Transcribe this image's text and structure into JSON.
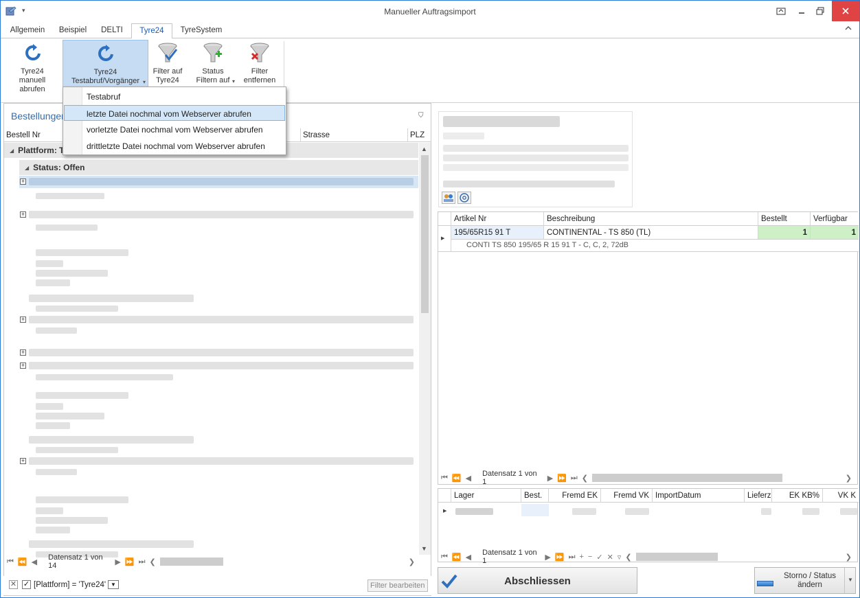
{
  "window": {
    "title": "Manueller Auftragsimport",
    "qat_symbol": "▾"
  },
  "tabs": [
    "Allgemein",
    "Beispiel",
    "DELTI",
    "Tyre24",
    "TyreSystem"
  ],
  "active_tab": "Tyre24",
  "ribbon": {
    "btn_manual": "Tyre24 manuell abrufen",
    "btn_test_line1": "Tyre24",
    "btn_test_line2": "Testabruf/Vorgänger",
    "btn_filter_line1": "Filter auf",
    "btn_filter_line2": "Tyre24",
    "btn_status_line1": "Status",
    "btn_status_line2": "Filtern auf",
    "btn_remove_line1": "Filter",
    "btn_remove_line2": "entfernen"
  },
  "dropdown": {
    "items": [
      "Testabruf",
      "letzte  Datei nochmal vom Webserver abrufen",
      "vorletzte  Datei nochmal vom Webserver abrufen",
      "drittletzte  Datei nochmal vom Webserver abrufen"
    ],
    "selected_index": 1
  },
  "left": {
    "title": "Bestellungen",
    "columns": [
      "Bestell Nr",
      "Strasse",
      "PLZ"
    ],
    "group_platform": "Plattform: T",
    "group_status": "Status: Offen",
    "nav_record": "Datensatz 1 von 14",
    "filter_text": "[Plattform] = 'Tyre24'",
    "filter_edit": "Filter bearbeiten"
  },
  "articles": {
    "columns": [
      "Artikel Nr",
      "Beschreibung",
      "Bestellt",
      "Verfügbar"
    ],
    "rows": [
      {
        "artikel_nr": "195/65R15 91 T",
        "beschreibung": "CONTINENTAL - TS 850 (TL)",
        "bestellt": "1",
        "verfuegbar": "1"
      }
    ],
    "detail": "CONTI    TS 850 195/65 R 15 91 T - C, C, 2, 72dB",
    "nav_record": "Datensatz 1 von 1"
  },
  "stock": {
    "columns": [
      "Lager",
      "Best.",
      "Fremd EK",
      "Fremd VK",
      "ImportDatum",
      "Lieferzeit",
      "EK KB%",
      "VK K"
    ],
    "nav_record": "Datensatz 1 von 1"
  },
  "actions": {
    "finish": "Abschliessen",
    "storno_line1": "Storno / Status",
    "storno_line2": "ändern"
  },
  "colors": {
    "accent": "#2c6db5",
    "hot": "#c5dcf3",
    "green": "#cdf0c6",
    "close": "#e04343"
  }
}
